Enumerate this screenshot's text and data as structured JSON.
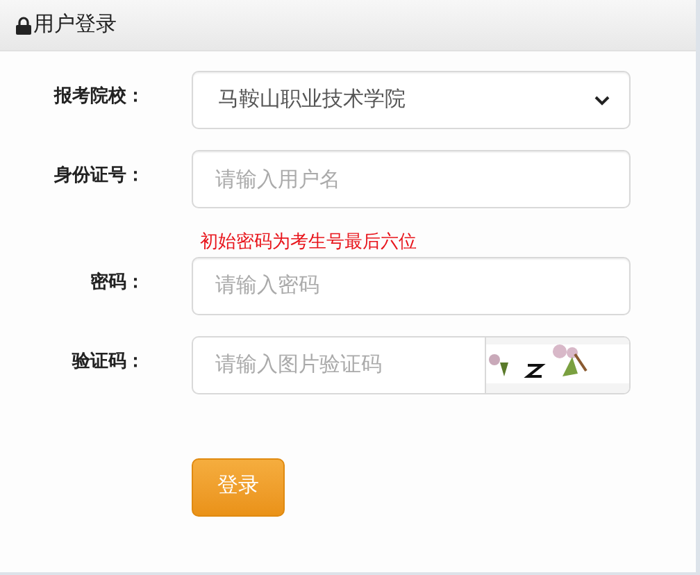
{
  "header": {
    "title": "用户登录"
  },
  "form": {
    "school": {
      "label": "报考院校：",
      "value": "马鞍山职业技术学院"
    },
    "id_number": {
      "label": "身份证号：",
      "placeholder": "请输入用户名"
    },
    "hint": "初始密码为考生号最后六位",
    "password": {
      "label": "密码：",
      "placeholder": "请输入密码"
    },
    "captcha": {
      "label": "验证码：",
      "placeholder": "请输入图片验证码"
    },
    "submit": "登录"
  }
}
